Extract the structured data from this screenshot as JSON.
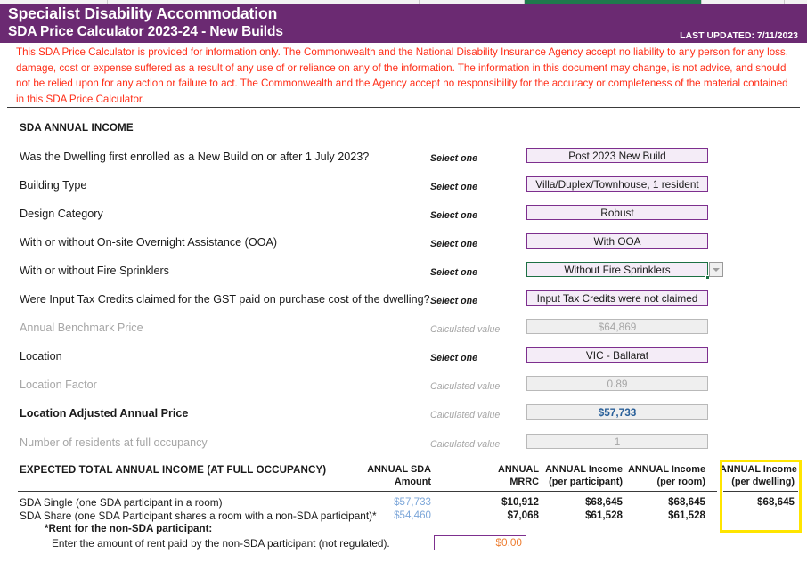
{
  "header": {
    "title": "Specialist Disability Accommodation",
    "subtitle": "SDA Price Calculator 2023-24 - New Builds",
    "last_updated": "LAST UPDATED: 7/11/2023",
    "banner_color": "#6b2a72"
  },
  "disclaimer": {
    "text": "This SDA Price Calculator is provided for information only.  The Commonwealth and the National Disability Insurance Agency accept no liability to any person for any loss, damage, cost or expense suffered as a result of any use of or reliance on any of the information.  The information in this document may change, is not advice, and should not be relied upon for any action or failure to act. The Commonwealth and the Agency accept no responsibility for the accuracy or completeness of the material contained in this SDA Price Calculator.",
    "color": "#ff2d17"
  },
  "section": {
    "heading": "SDA ANNUAL INCOME"
  },
  "hints": {
    "select_one": "Select one",
    "calculated_value": "Calculated value"
  },
  "rows": [
    {
      "label": "Was the Dwelling first enrolled as a New Build on or after 1 July 2023?",
      "hint": "Select one",
      "value": "Post 2023 New Build",
      "kind": "select"
    },
    {
      "label": "Building Type",
      "hint": "Select one",
      "value": "Villa/Duplex/Townhouse, 1 resident",
      "kind": "select"
    },
    {
      "label": "Design Category",
      "hint": "Select one",
      "value": "Robust",
      "kind": "select"
    },
    {
      "label": "With or without On-site Overnight Assistance (OOA)",
      "hint": "Select one",
      "value": "With OOA",
      "kind": "select"
    },
    {
      "label": "With or without Fire Sprinklers",
      "hint": "Select one",
      "value": "Without Fire Sprinklers",
      "kind": "active"
    },
    {
      "label": "Were Input Tax Credits claimed for the GST paid on purchase cost of the dwelling?",
      "hint": "Select one",
      "value": "Input Tax Credits were not claimed",
      "kind": "select"
    },
    {
      "label": "Annual Benchmark Price",
      "hint": "Calculated value",
      "value": "$64,869",
      "kind": "calc"
    },
    {
      "label": "Location",
      "hint": "Select one",
      "value": "VIC - Ballarat",
      "kind": "select"
    },
    {
      "label": "Location Factor",
      "hint": "Calculated value",
      "value": "0.89",
      "kind": "calc"
    },
    {
      "label": "Location Adjusted Annual Price",
      "hint": "Calculated value",
      "value": "$57,733",
      "kind": "calc-highlight"
    },
    {
      "label": "Number of residents at full occupancy",
      "hint": "Calculated value",
      "value": "1",
      "kind": "calc"
    }
  ],
  "table": {
    "title": "EXPECTED TOTAL ANNUAL INCOME (AT FULL OCCUPANCY)",
    "columns": [
      {
        "line1": "ANNUAL SDA",
        "line2": "Amount"
      },
      {
        "line1": "ANNUAL",
        "line2": "MRRC"
      },
      {
        "line1": "ANNUAL Income",
        "line2": "(per participant)"
      },
      {
        "line1": "ANNUAL Income",
        "line2": "(per room)"
      },
      {
        "line1": "ANNUAL Income",
        "line2": "(per dwelling)"
      }
    ],
    "rows": [
      {
        "label": "SDA Single (one SDA participant in a room)",
        "sda_amount": "$57,733",
        "mrrc": "$10,912",
        "per_participant": "$68,645",
        "per_room": "$68,645",
        "per_dwelling": "$68,645"
      },
      {
        "label": "SDA Share (one SDA Participant shares a room with a non-SDA participant)*",
        "sda_amount": "$54,460",
        "mrrc": "$7,068",
        "per_participant": "$61,528",
        "per_room": "$61,528",
        "per_dwelling": ""
      }
    ],
    "footnote_bold": "*Rent for the non-SDA participant:",
    "footnote": "Enter the amount of rent paid by the non-SDA participant (not regulated).",
    "rent_value": "$0.00",
    "rent_placeholder": "$0.00",
    "highlight_color": "#ffe500"
  }
}
